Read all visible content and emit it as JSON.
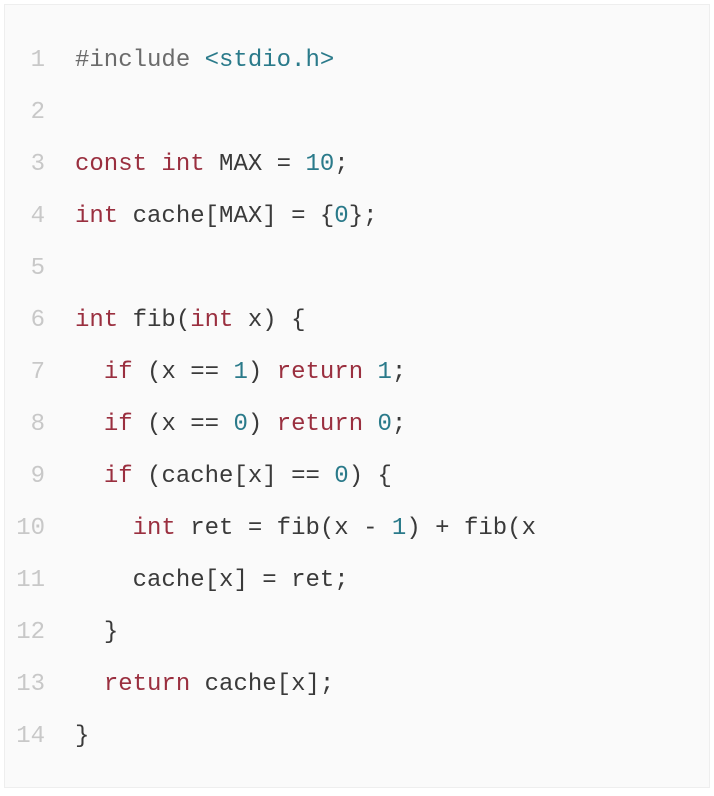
{
  "code": {
    "language": "c",
    "lines": [
      {
        "number": "1",
        "tokens": [
          {
            "cls": "tok-preproc",
            "text": "#include"
          },
          {
            "cls": "tok-plain",
            "text": " "
          },
          {
            "cls": "tok-include",
            "text": "<stdio.h>"
          }
        ]
      },
      {
        "number": "2",
        "tokens": []
      },
      {
        "number": "3",
        "tokens": [
          {
            "cls": "tok-keyword",
            "text": "const"
          },
          {
            "cls": "tok-plain",
            "text": " "
          },
          {
            "cls": "tok-type",
            "text": "int"
          },
          {
            "cls": "tok-plain",
            "text": " "
          },
          {
            "cls": "tok-ident",
            "text": "MAX"
          },
          {
            "cls": "tok-plain",
            "text": " "
          },
          {
            "cls": "tok-op",
            "text": "="
          },
          {
            "cls": "tok-plain",
            "text": " "
          },
          {
            "cls": "tok-number",
            "text": "10"
          },
          {
            "cls": "tok-punct",
            "text": ";"
          }
        ]
      },
      {
        "number": "4",
        "tokens": [
          {
            "cls": "tok-type",
            "text": "int"
          },
          {
            "cls": "tok-plain",
            "text": " "
          },
          {
            "cls": "tok-ident",
            "text": "cache"
          },
          {
            "cls": "tok-punct",
            "text": "["
          },
          {
            "cls": "tok-ident",
            "text": "MAX"
          },
          {
            "cls": "tok-punct",
            "text": "]"
          },
          {
            "cls": "tok-plain",
            "text": " "
          },
          {
            "cls": "tok-op",
            "text": "="
          },
          {
            "cls": "tok-plain",
            "text": " "
          },
          {
            "cls": "tok-punct",
            "text": "{"
          },
          {
            "cls": "tok-number",
            "text": "0"
          },
          {
            "cls": "tok-punct",
            "text": "}"
          },
          {
            "cls": "tok-punct",
            "text": ";"
          }
        ]
      },
      {
        "number": "5",
        "tokens": []
      },
      {
        "number": "6",
        "tokens": [
          {
            "cls": "tok-type",
            "text": "int"
          },
          {
            "cls": "tok-plain",
            "text": " "
          },
          {
            "cls": "tok-func",
            "text": "fib"
          },
          {
            "cls": "tok-punct",
            "text": "("
          },
          {
            "cls": "tok-type",
            "text": "int"
          },
          {
            "cls": "tok-plain",
            "text": " "
          },
          {
            "cls": "tok-ident",
            "text": "x"
          },
          {
            "cls": "tok-punct",
            "text": ")"
          },
          {
            "cls": "tok-plain",
            "text": " "
          },
          {
            "cls": "tok-punct",
            "text": "{"
          }
        ]
      },
      {
        "number": "7",
        "tokens": [
          {
            "cls": "tok-plain",
            "text": "  "
          },
          {
            "cls": "tok-keyword",
            "text": "if"
          },
          {
            "cls": "tok-plain",
            "text": " "
          },
          {
            "cls": "tok-punct",
            "text": "("
          },
          {
            "cls": "tok-ident",
            "text": "x"
          },
          {
            "cls": "tok-plain",
            "text": " "
          },
          {
            "cls": "tok-op",
            "text": "=="
          },
          {
            "cls": "tok-plain",
            "text": " "
          },
          {
            "cls": "tok-number",
            "text": "1"
          },
          {
            "cls": "tok-punct",
            "text": ")"
          },
          {
            "cls": "tok-plain",
            "text": " "
          },
          {
            "cls": "tok-keyword",
            "text": "return"
          },
          {
            "cls": "tok-plain",
            "text": " "
          },
          {
            "cls": "tok-number",
            "text": "1"
          },
          {
            "cls": "tok-punct",
            "text": ";"
          }
        ]
      },
      {
        "number": "8",
        "tokens": [
          {
            "cls": "tok-plain",
            "text": "  "
          },
          {
            "cls": "tok-keyword",
            "text": "if"
          },
          {
            "cls": "tok-plain",
            "text": " "
          },
          {
            "cls": "tok-punct",
            "text": "("
          },
          {
            "cls": "tok-ident",
            "text": "x"
          },
          {
            "cls": "tok-plain",
            "text": " "
          },
          {
            "cls": "tok-op",
            "text": "=="
          },
          {
            "cls": "tok-plain",
            "text": " "
          },
          {
            "cls": "tok-number",
            "text": "0"
          },
          {
            "cls": "tok-punct",
            "text": ")"
          },
          {
            "cls": "tok-plain",
            "text": " "
          },
          {
            "cls": "tok-keyword",
            "text": "return"
          },
          {
            "cls": "tok-plain",
            "text": " "
          },
          {
            "cls": "tok-number",
            "text": "0"
          },
          {
            "cls": "tok-punct",
            "text": ";"
          }
        ]
      },
      {
        "number": "9",
        "tokens": [
          {
            "cls": "tok-plain",
            "text": "  "
          },
          {
            "cls": "tok-keyword",
            "text": "if"
          },
          {
            "cls": "tok-plain",
            "text": " "
          },
          {
            "cls": "tok-punct",
            "text": "("
          },
          {
            "cls": "tok-ident",
            "text": "cache"
          },
          {
            "cls": "tok-punct",
            "text": "["
          },
          {
            "cls": "tok-ident",
            "text": "x"
          },
          {
            "cls": "tok-punct",
            "text": "]"
          },
          {
            "cls": "tok-plain",
            "text": " "
          },
          {
            "cls": "tok-op",
            "text": "=="
          },
          {
            "cls": "tok-plain",
            "text": " "
          },
          {
            "cls": "tok-number",
            "text": "0"
          },
          {
            "cls": "tok-punct",
            "text": ")"
          },
          {
            "cls": "tok-plain",
            "text": " "
          },
          {
            "cls": "tok-punct",
            "text": "{"
          }
        ]
      },
      {
        "number": "10",
        "tokens": [
          {
            "cls": "tok-plain",
            "text": "    "
          },
          {
            "cls": "tok-type",
            "text": "int"
          },
          {
            "cls": "tok-plain",
            "text": " "
          },
          {
            "cls": "tok-ident",
            "text": "ret"
          },
          {
            "cls": "tok-plain",
            "text": " "
          },
          {
            "cls": "tok-op",
            "text": "="
          },
          {
            "cls": "tok-plain",
            "text": " "
          },
          {
            "cls": "tok-func",
            "text": "fib"
          },
          {
            "cls": "tok-punct",
            "text": "("
          },
          {
            "cls": "tok-ident",
            "text": "x"
          },
          {
            "cls": "tok-plain",
            "text": " "
          },
          {
            "cls": "tok-op",
            "text": "-"
          },
          {
            "cls": "tok-plain",
            "text": " "
          },
          {
            "cls": "tok-number",
            "text": "1"
          },
          {
            "cls": "tok-punct",
            "text": ")"
          },
          {
            "cls": "tok-plain",
            "text": " "
          },
          {
            "cls": "tok-op",
            "text": "+"
          },
          {
            "cls": "tok-plain",
            "text": " "
          },
          {
            "cls": "tok-func",
            "text": "fib"
          },
          {
            "cls": "tok-punct",
            "text": "("
          },
          {
            "cls": "tok-ident",
            "text": "x"
          }
        ]
      },
      {
        "number": "11",
        "tokens": [
          {
            "cls": "tok-plain",
            "text": "    "
          },
          {
            "cls": "tok-ident",
            "text": "cache"
          },
          {
            "cls": "tok-punct",
            "text": "["
          },
          {
            "cls": "tok-ident",
            "text": "x"
          },
          {
            "cls": "tok-punct",
            "text": "]"
          },
          {
            "cls": "tok-plain",
            "text": " "
          },
          {
            "cls": "tok-op",
            "text": "="
          },
          {
            "cls": "tok-plain",
            "text": " "
          },
          {
            "cls": "tok-ident",
            "text": "ret"
          },
          {
            "cls": "tok-punct",
            "text": ";"
          }
        ]
      },
      {
        "number": "12",
        "tokens": [
          {
            "cls": "tok-plain",
            "text": "  "
          },
          {
            "cls": "tok-punct",
            "text": "}"
          }
        ]
      },
      {
        "number": "13",
        "tokens": [
          {
            "cls": "tok-plain",
            "text": "  "
          },
          {
            "cls": "tok-keyword",
            "text": "return"
          },
          {
            "cls": "tok-plain",
            "text": " "
          },
          {
            "cls": "tok-ident",
            "text": "cache"
          },
          {
            "cls": "tok-punct",
            "text": "["
          },
          {
            "cls": "tok-ident",
            "text": "x"
          },
          {
            "cls": "tok-punct",
            "text": "]"
          },
          {
            "cls": "tok-punct",
            "text": ";"
          }
        ]
      },
      {
        "number": "14",
        "tokens": [
          {
            "cls": "tok-punct",
            "text": "}"
          }
        ]
      }
    ]
  }
}
